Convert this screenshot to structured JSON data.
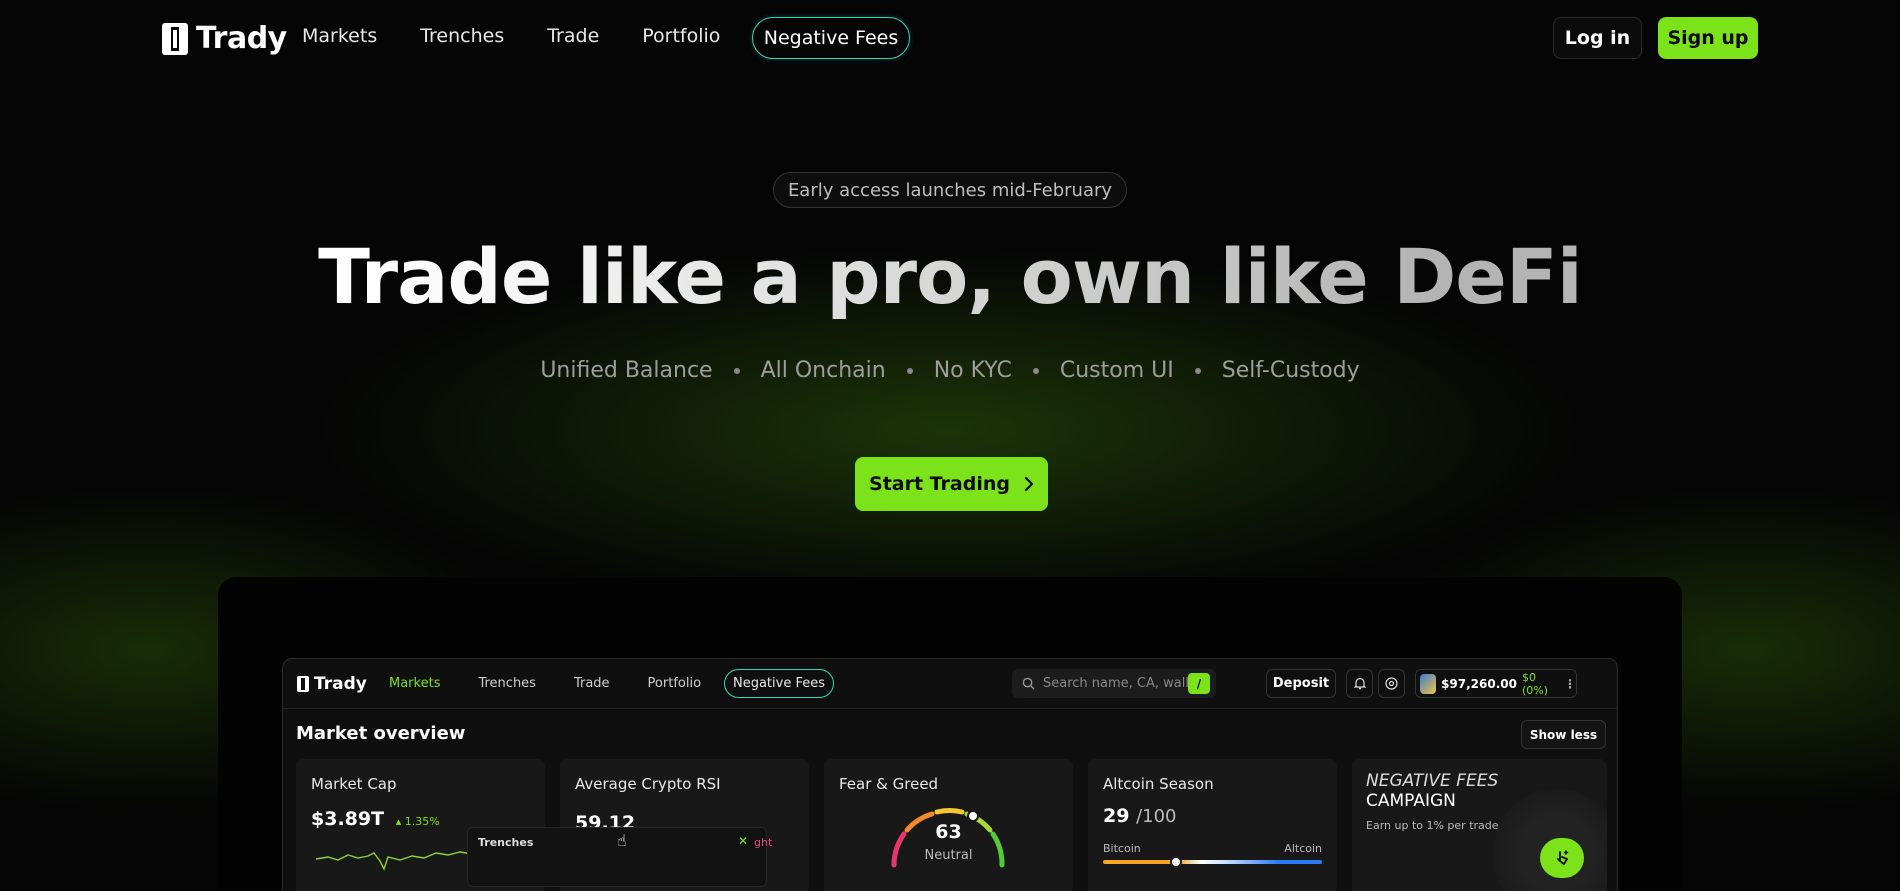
{
  "nav": {
    "logo": "Trady",
    "links": [
      "Markets",
      "Trenches",
      "Trade",
      "Portfolio"
    ],
    "pill": "Negative Fees",
    "login": "Log in",
    "signup": "Sign up"
  },
  "hero": {
    "badge": "Early access launches mid-February",
    "title": "Trade like a pro, own like DeFi",
    "features": [
      "Unified Balance",
      "All Onchain",
      "No KYC",
      "Custom UI",
      "Self-Custody"
    ],
    "cta": "Start Trading"
  },
  "app": {
    "logo": "Trady",
    "links": [
      "Markets",
      "Trenches",
      "Trade",
      "Portfolio"
    ],
    "pill": "Negative Fees",
    "search_placeholder": "Search name, CA, wallet",
    "search_shortcut": "/",
    "deposit": "Deposit",
    "balance": "$97,260.00",
    "balance_change": "$0 (0%)",
    "section_title": "Market overview",
    "show_less": "Show less",
    "cards": {
      "market_cap": {
        "title": "Market Cap",
        "value": "$3.89T",
        "change": "1.35%"
      },
      "rsi": {
        "title": "Average Crypto RSI",
        "value": "59.12"
      },
      "fear_greed": {
        "title": "Fear & Greed",
        "value": "63",
        "label": "Neutral"
      },
      "altcoin": {
        "title": "Altcoin Season",
        "value": "29",
        "denominator": "/100",
        "left_label": "Bitcoin",
        "right_label": "Altcoin"
      },
      "negative_fees": {
        "title": "NEGATIVE FEES",
        "title2": "CAMPAIGN",
        "subtitle": "Earn up to 1% per trade"
      }
    },
    "trenches_popup": {
      "title": "Trenches",
      "close": "✕",
      "tail": "ght"
    }
  },
  "colors": {
    "accent": "#7ce21a",
    "pill_border": "#39d6b0",
    "background": "#050505"
  }
}
